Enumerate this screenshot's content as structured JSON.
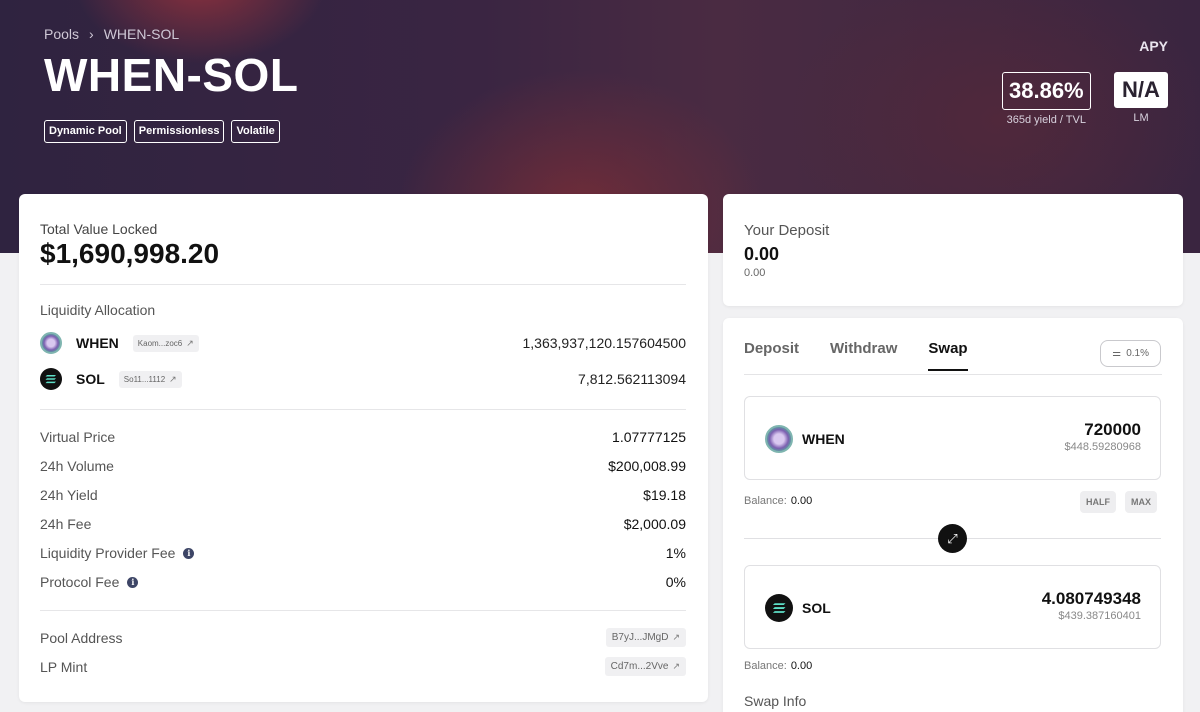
{
  "breadcrumb": {
    "root": "Pools",
    "current": "WHEN-SOL"
  },
  "title": "WHEN-SOL",
  "tags": [
    "Dynamic Pool",
    "Permissionless",
    "Volatile"
  ],
  "apy": {
    "label": "APY",
    "yield_value": "38.86%",
    "yield_sub": "365d yield / TVL",
    "lm_value": "N/A",
    "lm_sub": "LM"
  },
  "main": {
    "tvl_label": "Total Value Locked",
    "tvl_value": "$1,690,998.20",
    "alloc_label": "Liquidity Allocation",
    "tokens": [
      {
        "symbol": "WHEN",
        "address": "Kaom...zoc6",
        "amount": "1,363,937,120.157604500",
        "icon": "when-token-icon"
      },
      {
        "symbol": "SOL",
        "address": "So11...1112",
        "amount": "7,812.562113094",
        "icon": "sol-token-icon"
      }
    ],
    "stats": [
      {
        "key": "Virtual Price",
        "value": "1.07777125"
      },
      {
        "key": "24h Volume",
        "value": "$200,008.99"
      },
      {
        "key": "24h Yield",
        "value": "$19.18"
      },
      {
        "key": "24h Fee",
        "value": "$2,000.09"
      },
      {
        "key": "Liquidity Provider Fee",
        "value": "1%"
      },
      {
        "key": "Protocol Fee",
        "value": "0%"
      }
    ],
    "addresses": [
      {
        "key": "Pool Address",
        "value": "B7yJ...JMgD"
      },
      {
        "key": "LP Mint",
        "value": "Cd7m...2Vve"
      }
    ]
  },
  "deposit": {
    "label": "Your Deposit",
    "value": "0.00",
    "sub": "0.00"
  },
  "swap": {
    "tabs": [
      "Deposit",
      "Withdraw",
      "Swap"
    ],
    "active_tab": "Swap",
    "slippage": "0.1%",
    "from": {
      "symbol": "WHEN",
      "amount": "720000",
      "usd": "$448.59280968",
      "balance_label": "Balance:",
      "balance": "0.00"
    },
    "half_label": "HALF",
    "max_label": "MAX",
    "to": {
      "symbol": "SOL",
      "amount": "4.080749348",
      "usd": "$439.387160401",
      "balance_label": "Balance:",
      "balance": "0.00"
    },
    "info_label": "Swap Info"
  }
}
